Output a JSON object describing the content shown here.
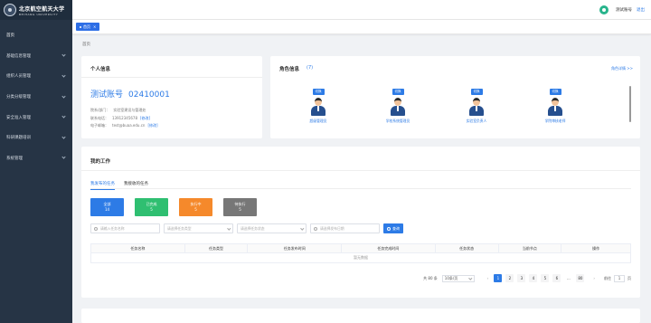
{
  "sidebar": {
    "logo_cn": "北京航空航天大学",
    "logo_en": "BEIHANG UNIVERSITY",
    "items": [
      {
        "label": "首页",
        "has_children": false
      },
      {
        "label": "基础信息管理",
        "has_children": true
      },
      {
        "label": "组织人员管理",
        "has_children": true
      },
      {
        "label": "分类分级管理",
        "has_children": true
      },
      {
        "label": "安全准入管理",
        "has_children": true
      },
      {
        "label": "科研课题培训",
        "has_children": true
      },
      {
        "label": "系统管理",
        "has_children": true
      }
    ]
  },
  "header": {
    "user_name": "测试账号",
    "logout_label": "退出"
  },
  "tags": {
    "active_label": "首页",
    "close_glyph": "×"
  },
  "breadcrumb": "首页",
  "personal": {
    "title": "个人信息",
    "account_name": "测试账号",
    "account_id": "02410001",
    "dept_label": "院系/部门：",
    "dept_value": "实验室建设与管理处",
    "phone_label": "联系电话：",
    "phone_value": "13912345678",
    "phone_edit": "[修改]",
    "email_label": "电子邮箱：",
    "email_value": "test@buaa.edu.cn",
    "email_edit": "[修改]"
  },
  "roles": {
    "title": "角色信息",
    "count": "(7)",
    "more_label": "角色详情 >>",
    "items": [
      {
        "tag": "切换",
        "name": "超级管理员"
      },
      {
        "tag": "切换",
        "name": "学校系统管理员"
      },
      {
        "tag": "切换",
        "name": "实验室负责人"
      },
      {
        "tag": "切换",
        "name": "学院审核老师"
      }
    ]
  },
  "work": {
    "title": "我的工作",
    "tabs": [
      {
        "label": "我发布的任务",
        "active": true
      },
      {
        "label": "我接收的任务",
        "active": false
      }
    ],
    "stats": [
      {
        "label": "全部",
        "value": "14",
        "color": "#2d7be6"
      },
      {
        "label": "已完成",
        "value": "5",
        "color": "#2fbf71"
      },
      {
        "label": "执行中",
        "value": "5",
        "color": "#f5892b"
      },
      {
        "label": "待执行",
        "value": "5",
        "color": "#777777"
      }
    ],
    "filters": {
      "name_placeholder": "请输入任务名称",
      "type_placeholder": "请选择任务类型",
      "status_placeholder": "请选择任务状态",
      "date_placeholder": "请选择发布日期",
      "search_label": "查询"
    },
    "table": {
      "columns": [
        "任务名称",
        "任务类型",
        "任务发布时间",
        "任务完成时间",
        "任务状态",
        "当前节点",
        "操作"
      ],
      "empty_text": "暂无数据"
    },
    "pagination": {
      "total": "共 80 条",
      "page_size": "10条/页",
      "pages": [
        "1",
        "2",
        "3",
        "4",
        "5",
        "6",
        "...",
        "80"
      ],
      "current": "1",
      "goto_prefix": "前往",
      "goto_value": "1",
      "goto_suffix": "页"
    }
  }
}
